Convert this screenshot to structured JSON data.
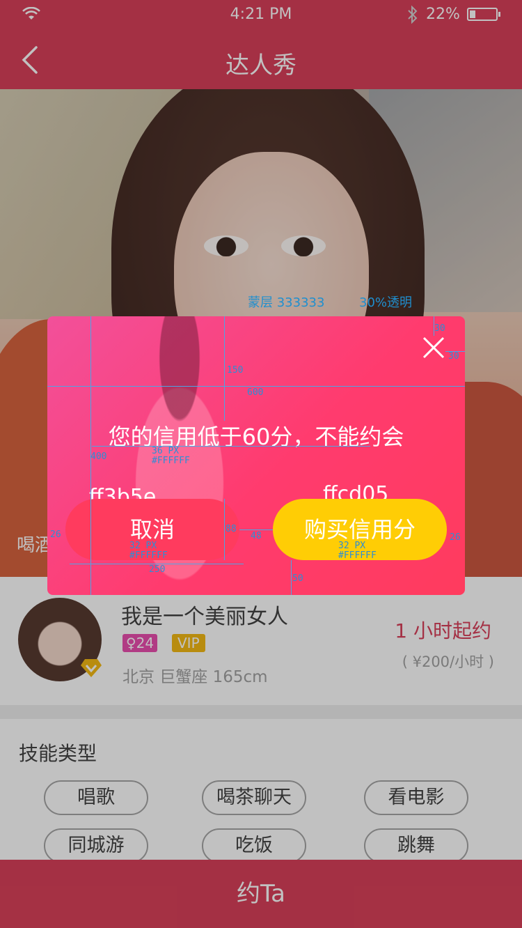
{
  "status_bar": {
    "time": "4:21 PM",
    "battery_percent": "22%",
    "battery_level": 0.22
  },
  "nav": {
    "title": "达人秀"
  },
  "hero": {
    "caption": "喝酒"
  },
  "profile": {
    "name": "我是一个美丽女人",
    "age_badge": "♀24",
    "vip_badge": "VIP",
    "info": "北京   巨蟹座   165cm",
    "price_main": "1 小时起约",
    "price_sub": "( ¥200/小时 )"
  },
  "skills": {
    "heading": "技能类型",
    "tags": [
      "唱歌",
      "喝茶聊天",
      "看电影",
      "同城游",
      "吃饭",
      "跳舞"
    ]
  },
  "bottom_bar": {
    "label": "约Ta"
  },
  "dialog": {
    "message": "您的信用低于60分，不能约会",
    "cancel_label": "取消",
    "buy_label": "购买信用分",
    "cancel_color_note": "ff3b5e",
    "buy_color_note": "ffcd05"
  },
  "annotations": {
    "mask_label": "蒙层  333333",
    "mask_opacity": "30%透明",
    "close_offset_top": "30",
    "close_offset_right": "30",
    "title_offset": "150",
    "dialog_width": "600",
    "dialog_height": "400",
    "text_size_36": "36 PX",
    "text_color_36": "#FFFFFF",
    "btn_left_margin": "26",
    "btn_height": "88",
    "btn_gap": "48",
    "btn_right_margin": "26",
    "btn_text_size_cancel": "32 PX",
    "btn_text_color_cancel": "#FFFFFF",
    "btn_text_size_buy": "32 PX",
    "btn_text_color_buy": "#FFFFFF",
    "btn_width": "250",
    "btn_bottom_margin": "50"
  },
  "colors": {
    "brand": "#d6304c",
    "cancel_button": "#ff3b5e",
    "buy_button": "#ffcd05",
    "mask": "#333333"
  }
}
